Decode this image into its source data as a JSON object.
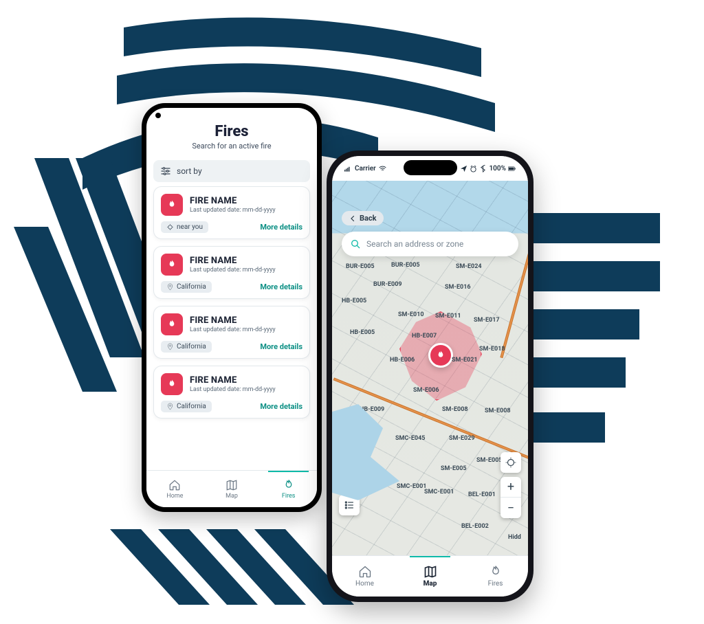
{
  "colors": {
    "accent": "#0fbaa8",
    "danger": "#e63957",
    "navy": "#0e3c5a"
  },
  "phone1": {
    "header": {
      "title": "Fires",
      "subtitle": "Search for an active fire"
    },
    "sort_label": "sort by",
    "fires": [
      {
        "name": "FIRE NAME",
        "updated": "Last updated date: mm-dd-yyyy",
        "location": "near you",
        "location_icon": "crosshair",
        "cta": "More details"
      },
      {
        "name": "FIRE NAME",
        "updated": "Last updated date: mm-dd-yyyy",
        "location": "California",
        "location_icon": "pin",
        "cta": "More details"
      },
      {
        "name": "FIRE NAME",
        "updated": "Last updated date: mm-dd-yyyy",
        "location": "California",
        "location_icon": "pin",
        "cta": "More details"
      },
      {
        "name": "FIRE NAME",
        "updated": "Last updated date: mm-dd-yyyy",
        "location": "California",
        "location_icon": "pin",
        "cta": "More details"
      }
    ],
    "nav": [
      {
        "label": "Home",
        "icon": "home",
        "active": false
      },
      {
        "label": "Map",
        "icon": "map",
        "active": false
      },
      {
        "label": "Fires",
        "icon": "flame",
        "active": true
      }
    ]
  },
  "phone2": {
    "status": {
      "carrier": "Carrier",
      "battery": "100%"
    },
    "back_label": "Back",
    "search_placeholder": "Search an address or zone",
    "map_controls": {
      "locate": "⌖",
      "zoom_in": "+",
      "zoom_out": "−"
    },
    "zones": [
      "HB-E005",
      "HB-E005",
      "HB-E006",
      "HB-E007",
      "HB-E009",
      "BUR-E005",
      "BUR-E005",
      "BUR-E009",
      "SM-E006",
      "SM-E008",
      "SM-E008",
      "SM-E010",
      "SM-E011",
      "SM-E016",
      "SM-E017",
      "SM-E018",
      "SM-E021",
      "SM-E024",
      "SM-E029",
      "SMC-E001",
      "SMC-E001",
      "SMC-E045",
      "BEL-E001",
      "BEL-E002",
      "SM-E005",
      "SM-E005",
      "Hidd"
    ],
    "nav": [
      {
        "label": "Home",
        "icon": "home",
        "active": false
      },
      {
        "label": "Map",
        "icon": "map",
        "active": true
      },
      {
        "label": "Fires",
        "icon": "flame",
        "active": false
      }
    ]
  }
}
